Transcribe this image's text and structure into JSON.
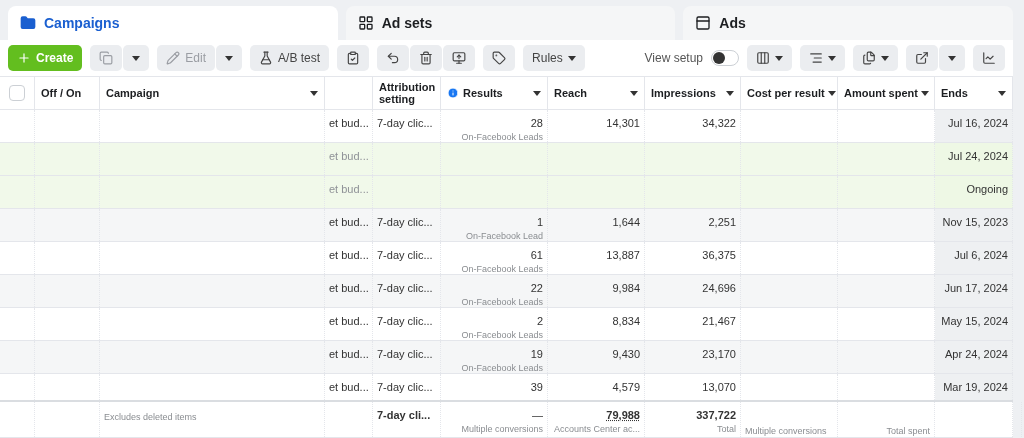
{
  "tabs": [
    {
      "label": "Campaigns",
      "selected": true
    },
    {
      "label": "Ad sets",
      "selected": false
    },
    {
      "label": "Ads",
      "selected": false
    }
  ],
  "toolbar": {
    "create": "Create",
    "duplicate_disabled": true,
    "edit": {
      "label": "Edit",
      "disabled": true
    },
    "ab_test": "A/B test",
    "rules": "Rules",
    "view_setup": {
      "label": "View setup",
      "on": false
    }
  },
  "table": {
    "select_all_checked": false,
    "columns": [
      {
        "label": "Off / On"
      },
      {
        "label": "Campaign",
        "caret": true
      },
      {
        "label": "Attribution setting"
      },
      {
        "label": "Results",
        "caret": true,
        "info": true
      },
      {
        "label": "Reach",
        "caret": true
      },
      {
        "label": "Impressions",
        "caret": true
      },
      {
        "label": "Cost per result",
        "caret": true
      },
      {
        "label": "Amount spent",
        "caret": true
      },
      {
        "label": "Ends",
        "caret": true
      }
    ],
    "rows": [
      {
        "column_3": "et bud...",
        "attribution": "7-day clic...",
        "results": "28",
        "result_type": "On-Facebook Leads",
        "reach": "14,301",
        "impressions": "34,322",
        "ends": "Jul 16, 2024",
        "highlighted": false
      },
      {
        "column_3": "et bud...",
        "ends": "Jul 24, 2024",
        "highlighted": true
      },
      {
        "column_3": "et bud...",
        "ends": "Ongoing",
        "highlighted": true
      },
      {
        "column_3": "et bud...",
        "attribution": "7-day clic...",
        "results": "1",
        "result_type": "On-Facebook Lead",
        "reach": "1,644",
        "impressions": "2,251",
        "ends": "Nov 15, 2023",
        "highlighted": false
      },
      {
        "column_3": "et bud...",
        "attribution": "7-day clic...",
        "results": "61",
        "result_type": "On-Facebook Leads",
        "reach": "13,887",
        "impressions": "36,375",
        "ends": "Jul 6, 2024",
        "highlighted": false
      },
      {
        "column_3": "et bud...",
        "attribution": "7-day clic...",
        "results": "22",
        "result_type": "On-Facebook Leads",
        "reach": "9,984",
        "impressions": "24,696",
        "ends": "Jun 17, 2024",
        "highlighted": false
      },
      {
        "column_3": "et bud...",
        "attribution": "7-day clic...",
        "results": "2",
        "result_type": "On-Facebook Leads",
        "reach": "8,834",
        "impressions": "21,467",
        "ends": "May 15, 2024",
        "highlighted": false
      },
      {
        "column_3": "et bud...",
        "attribution": "7-day clic...",
        "results": "19",
        "result_type": "On-Facebook Leads",
        "reach": "9,430",
        "impressions": "23,170",
        "ends": "Apr 24, 2024",
        "highlighted": false
      },
      {
        "column_3": "et bud...",
        "attribution": "7-day clic...",
        "results": "39",
        "reach": "4,579",
        "impressions": "13,070",
        "ends": "Mar 19, 2024",
        "highlighted": false
      }
    ],
    "footer": {
      "campaign_note": "Excludes deleted items",
      "attribution": "7-day cli...",
      "results": "—",
      "results_note": "Multiple conversions",
      "reach": "79,988",
      "reach_note": "Accounts Center ac...",
      "impressions": "337,722",
      "impressions_note": "Total",
      "cost_note": "Multiple conversions",
      "amount_note": "Total spent"
    }
  }
}
